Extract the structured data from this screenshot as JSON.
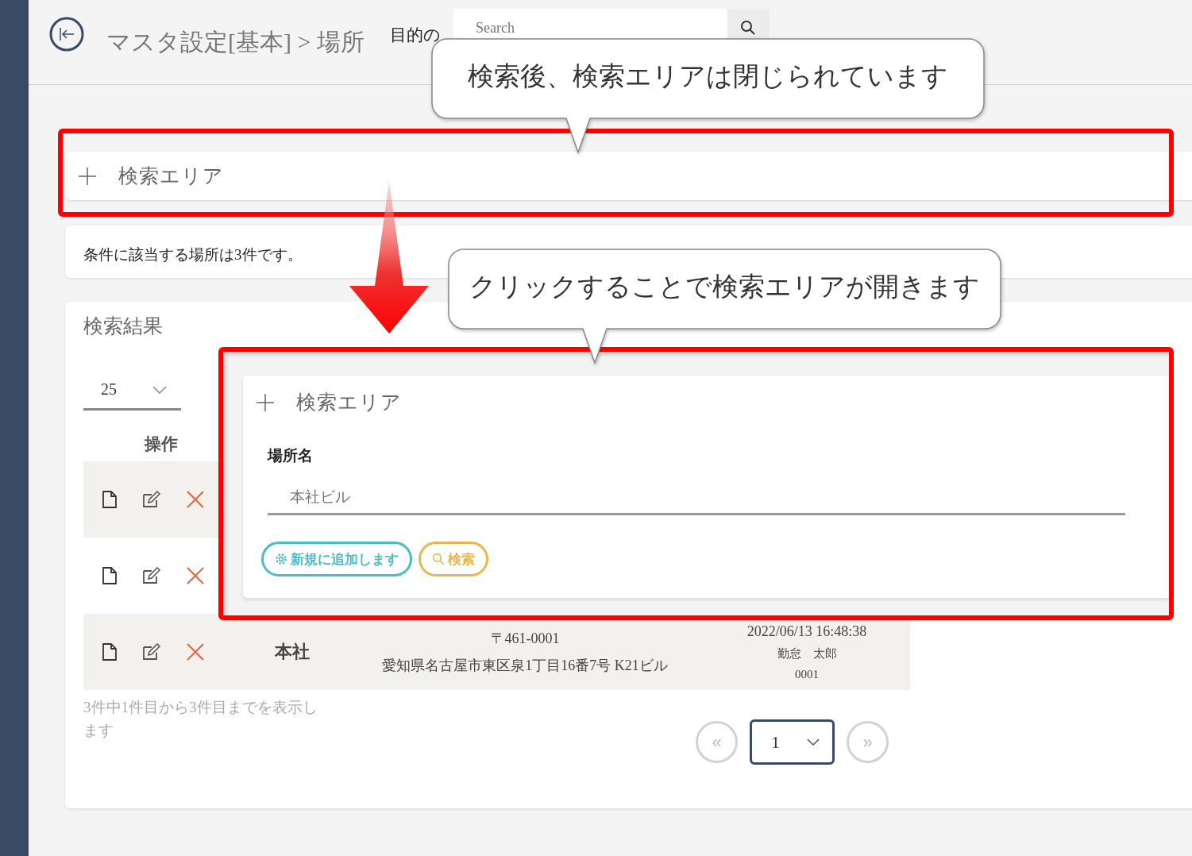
{
  "header": {
    "title": "マスタ設定[基本] > 場所",
    "search_label": "目的の",
    "search": {
      "placeholder": "Search"
    }
  },
  "search_area_closed": {
    "label": "検索エリア",
    "expanded": false
  },
  "result_count": "条件に該当する場所は3件です。",
  "results": {
    "title": "検索結果",
    "page_size": "25",
    "columns": [
      "操作"
    ],
    "rows": [
      {
        "kind": "covered"
      },
      {
        "kind": "covered"
      },
      {
        "kind": "full",
        "name": "本社",
        "postal": "〒461-0001",
        "address": "愛知県名古屋市東区泉1丁目16番7号 K21ビル",
        "updated": "2022/06/13 16:48:38",
        "user": "勤怠　太郎",
        "code": "0001"
      }
    ],
    "summary": "3件中1件目から3件目までを表示します",
    "pagination": {
      "prev": "«",
      "page": "1",
      "next": "»"
    }
  },
  "search_area_open": {
    "label": "検索エリア",
    "expanded": true,
    "field_label": "場所名",
    "field": {
      "placeholder": "本社ビル"
    },
    "buttons": [
      {
        "label": "新規に追加します",
        "kind": "add"
      },
      {
        "label": "検索",
        "kind": "search"
      }
    ]
  },
  "annotations": [
    {
      "text": "検索後、検索エリアは閉じられています"
    },
    {
      "text": "クリックすることで検索エリアが開きます"
    }
  ]
}
